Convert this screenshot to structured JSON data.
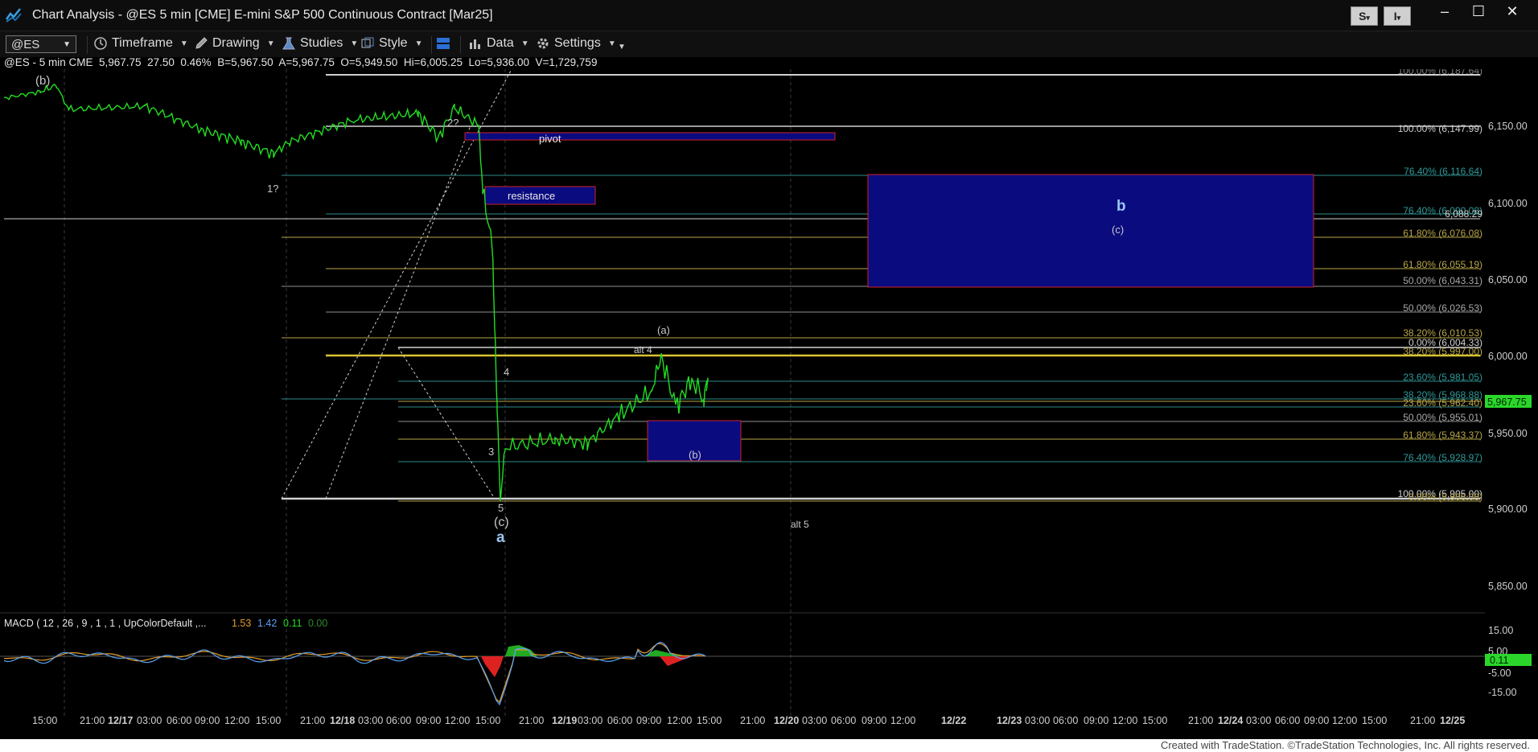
{
  "window": {
    "title": "Chart Analysis - @ES 5 min [CME] E-mini S&P 500 Continuous Contract [Mar25]",
    "buttons": [
      "S",
      "I"
    ],
    "controls": {
      "minimize": "–",
      "maximize": "☐",
      "close": "✕"
    }
  },
  "toolbar": {
    "symbol": "@ES",
    "items": [
      {
        "label": "Timeframe",
        "icon": "clock-icon"
      },
      {
        "label": "Drawing",
        "icon": "pencil-icon"
      },
      {
        "label": "Studies",
        "icon": "flask-icon"
      },
      {
        "label": "Style",
        "icon": "style-icon"
      },
      {
        "label": "",
        "icon": "layout-icon"
      },
      {
        "label": "Data",
        "icon": "bar-chart-icon"
      },
      {
        "label": "Settings",
        "icon": "gear-icon"
      }
    ]
  },
  "quote": {
    "symbol": "@ES - 5 min  CME",
    "last": "5,967.75",
    "change": "27.50",
    "pct": "0.46%",
    "bid": "B=5,967.50",
    "ask": "A=5,967.75",
    "open": "O=5,949.50",
    "high": "Hi=6,005.25",
    "low": "Lo=5,936.00",
    "volume": "V=1,729,759"
  },
  "price_axis": {
    "ticks": [
      "6,150.00",
      "6,100.00",
      "6,050.00",
      "6,000.00",
      "5,950.00",
      "5,900.00",
      "5,850.00"
    ],
    "last_price_tag": "5,967.75"
  },
  "macd": {
    "header": "MACD ( 12 , 26 , 9 , 1 , 1 , UpColorDefault ,...",
    "v1": "1.53",
    "v2": "1.42",
    "v3": "0.11",
    "v4": "0.00",
    "axis_ticks": [
      "15.00",
      "5.00",
      "-5.00",
      "-15.00"
    ],
    "value_tag": "0.11"
  },
  "time_axis": {
    "labels": [
      "15:00",
      "21:00",
      "12/17",
      "03:00",
      "06:00",
      "09:00",
      "12:00",
      "15:00",
      "21:00",
      "12/18",
      "03:00",
      "06:00",
      "09:00",
      "12:00",
      "15:00",
      "21:00",
      "12/19",
      "03:00",
      "06:00",
      "09:00",
      "12:00",
      "15:00",
      "21:00",
      "12/20",
      "03:00",
      "06:00",
      "09:00",
      "12:00",
      "12/22",
      "12/23",
      "03:00",
      "06:00",
      "09:00",
      "12:00",
      "15:00",
      "21:00",
      "12/24",
      "03:00",
      "06:00",
      "09:00",
      "12:00",
      "15:00",
      "21:00",
      "12/25"
    ]
  },
  "fib_labels": [
    "100.00% (6,187.64)",
    "100.00% (6,147.99)",
    "76.40% (6,116.64)",
    "76.40% (6,090.08)",
    "6,088.29",
    "61.80% (6,076.08)",
    "61.80% (6,055.19)",
    "50.00% (6,043.31)",
    "50.00% (6,026.53)",
    "38.20% (6,010.53)",
    "0.00% (6,004.33)",
    "38.20% (5,997.00)",
    "23.60% (5,981.05)",
    "38.20% (5,968.88)",
    "23.60% (5,962.40)",
    "50.00% (5,955.01)",
    "61.80% (5,943.37)",
    "76.40% (5,928.97)",
    "100.00% (5,905.00)",
    "0.00% (5,906.00)"
  ],
  "annotations": {
    "wave_b_top": "(b)",
    "wave_1": "1?",
    "wave_2": "2?",
    "pivot": "pivot",
    "resistance": "resistance",
    "wave_3": "3",
    "wave_4": "4",
    "wave_5": "5",
    "wave_c": "(c)",
    "wave_a": "a",
    "alt4": "alt 4",
    "wave_a_paren": "(a)",
    "wave_b_paren": "(b)",
    "alt5": "alt 5",
    "big_b": "b",
    "big_c": "(c)"
  },
  "footer": "Created with TradeStation. ©TradeStation Technologies, Inc. All rights reserved.",
  "colors": {
    "price_line": "#22dd22",
    "box_fill": "#0b0b80",
    "box_border": "#cc2222",
    "fib_gold": "#b8a648",
    "fib_teal": "#2e8a8a",
    "axis_text": "#cfcfcf"
  }
}
